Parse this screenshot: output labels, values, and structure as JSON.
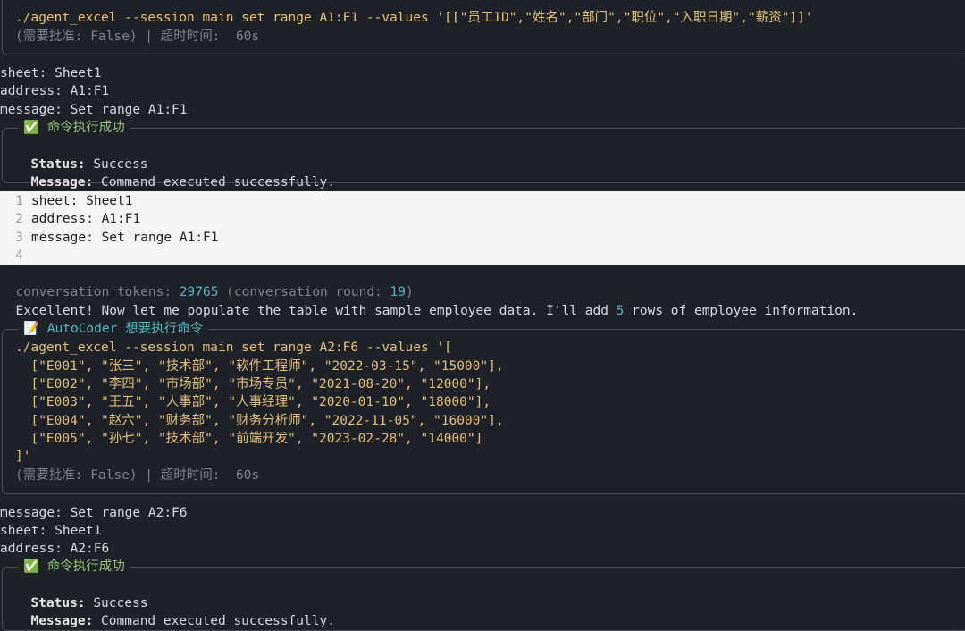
{
  "cmd1": {
    "command": "./agent_excel --session main set range A1:F1 --values '[[\"员工ID\",\"姓名\",\"部门\",\"职位\",\"入职日期\",\"薪资\"]]'",
    "approval": "(需要批准: False) | 超时时间:  60s"
  },
  "out1": [
    "sheet: Sheet1",
    "address: A1:F1",
    "message: Set range A1:F1"
  ],
  "result1": {
    "title": "✅ 命令执行成功",
    "status_label": "Status:",
    "status_value": "Success",
    "message_label": "Message:",
    "message_value": "Command executed successfully."
  },
  "yaml_panel": {
    "lines": [
      {
        "n": "1",
        "text": "sheet: Sheet1"
      },
      {
        "n": "2",
        "text": "address: A1:F1"
      },
      {
        "n": "3",
        "text": "message: Set range A1:F1"
      },
      {
        "n": "4",
        "text": ""
      }
    ]
  },
  "stats": {
    "tokens_label": "conversation tokens: ",
    "tokens_value": "29765",
    "round_label": " (conversation round: ",
    "round_value": "19",
    "round_close": ")"
  },
  "assistant": {
    "pre": "Excellent! Now let me populate the table with sample employee data. I'll add ",
    "count": "5",
    "post": " rows of employee information."
  },
  "cmd2": {
    "title": "📝 AutoCoder 想要执行命令",
    "lines": [
      "./agent_excel --session main set range A2:F6 --values '[",
      "  [\"E001\", \"张三\", \"技术部\", \"软件工程师\", \"2022-03-15\", \"15000\"],",
      "  [\"E002\", \"李四\", \"市场部\", \"市场专员\", \"2021-08-20\", \"12000\"],",
      "  [\"E003\", \"王五\", \"人事部\", \"人事经理\", \"2020-01-10\", \"18000\"],",
      "  [\"E004\", \"赵六\", \"财务部\", \"财务分析师\", \"2022-11-05\", \"16000\"],",
      "  [\"E005\", \"孙七\", \"技术部\", \"前端开发\", \"2023-02-28\", \"14000\"]",
      "]'"
    ],
    "approval": "(需要批准: False) | 超时时间:  60s"
  },
  "out2": [
    "message: Set range A2:F6",
    "sheet: Sheet1",
    "address: A2:F6"
  ],
  "result2": {
    "title": "✅ 命令执行成功",
    "status_label": "Status:",
    "status_value": "Success",
    "message_label": "Message:",
    "message_value": "Command executed successfully."
  }
}
